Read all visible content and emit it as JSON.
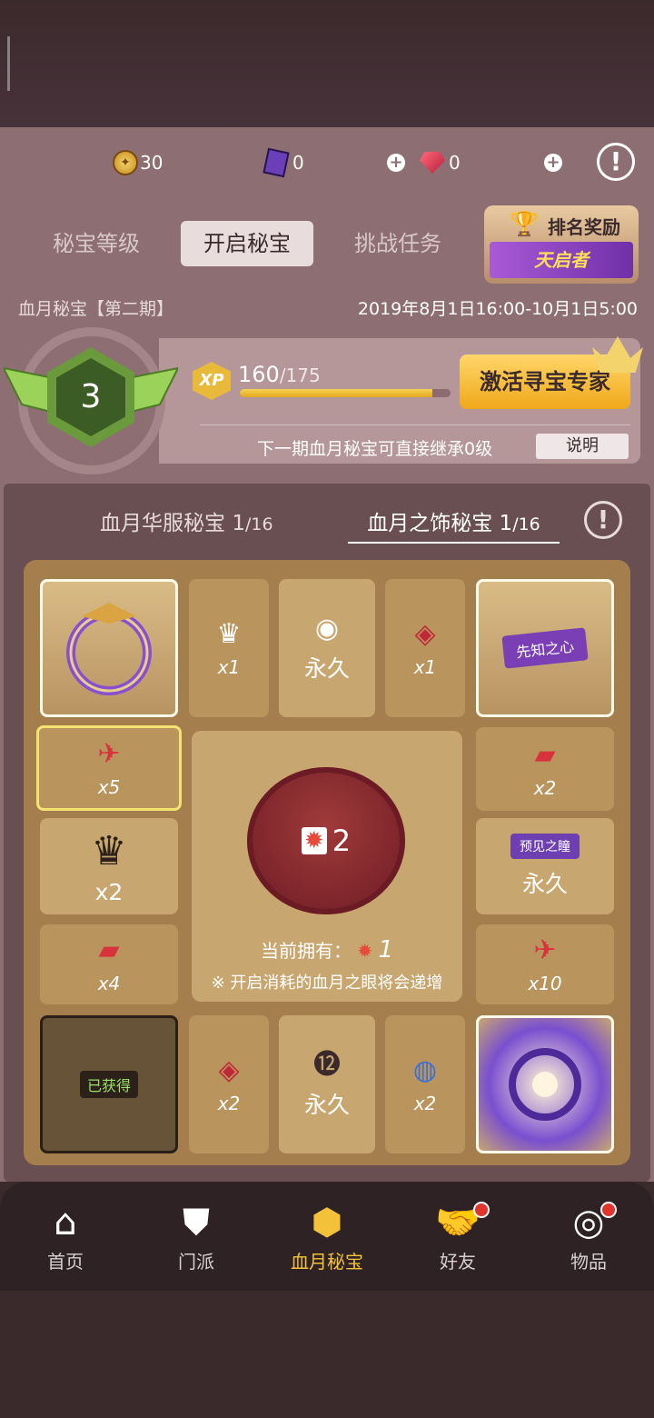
{
  "resources": {
    "gold": "30",
    "crystal": "0",
    "ruby": "0"
  },
  "tabs": [
    "秘宝等级",
    "开启秘宝",
    "挑战任务"
  ],
  "rank_reward": {
    "label": "排名奖励",
    "banner": "天启者"
  },
  "season": {
    "name": "血月秘宝【第二期】",
    "dates": "2019年8月1日16:00-10月1日5:00"
  },
  "level": {
    "value": "3"
  },
  "xp": {
    "icon": "XP",
    "current": "160",
    "max": "/175",
    "progress": 0.914
  },
  "activate_label": "激活寻宝专家",
  "inherit_text": "下一期血月秘宝可直接继承0级",
  "explain_label": "说明",
  "subtabs": [
    {
      "name": "血月华服秘宝",
      "count": "1",
      "total": "/16"
    },
    {
      "name": "血月之饰秘宝",
      "count": "1",
      "total": "/16"
    }
  ],
  "cells": {
    "c1": {
      "icon": "crown-icon",
      "qty": "x1"
    },
    "c2": {
      "icon": "eye-badge-icon",
      "perm": "永久"
    },
    "c3": {
      "icon": "eye-icon",
      "qty": "x1"
    },
    "c4": {
      "banner": "先知之心"
    },
    "c5": {
      "icon": "origami-crane-icon",
      "qty": "x5"
    },
    "c6": {
      "icon": "ticket-icon",
      "qty": "x2"
    },
    "c7": {
      "icon": "crown-icon",
      "qty": "x2"
    },
    "c8": {
      "banner": "预见之瞳",
      "perm": "永久"
    },
    "c9": {
      "icon": "ticket-icon",
      "qty": "x4"
    },
    "c10": {
      "icon": "origami-crane-icon",
      "qty": "x10"
    },
    "c11": {
      "status": "已获得"
    },
    "c12": {
      "icon": "eye-icon",
      "qty": "x2"
    },
    "c13": {
      "icon": "badge-12-icon",
      "perm": "永久"
    },
    "c14": {
      "icon": "ring-icon",
      "qty": "x2"
    }
  },
  "open_button": {
    "cost": "2"
  },
  "owned": {
    "label": "当前拥有：",
    "value": "1"
  },
  "note": "※ 开启消耗的血月之眼将会递增",
  "nav": [
    "首页",
    "门派",
    "血月秘宝",
    "好友",
    "物品"
  ]
}
